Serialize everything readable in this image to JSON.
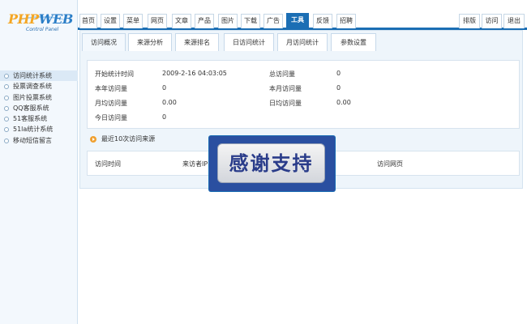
{
  "logo": {
    "brand_main": "PHP",
    "brand_accent": "WEB",
    "subtitle": "Control Panel"
  },
  "sidebar": {
    "items": [
      {
        "label": "访问统计系统",
        "active": true
      },
      {
        "label": "投票调查系统",
        "active": false
      },
      {
        "label": "图片投票系统",
        "active": false
      },
      {
        "label": "QQ客服系统",
        "active": false
      },
      {
        "label": "51客服系统",
        "active": false
      },
      {
        "label": "51la统计系统",
        "active": false
      },
      {
        "label": "移动短信留言",
        "active": false
      }
    ]
  },
  "topnav": {
    "tabs": [
      "首页",
      "设置",
      "菜单",
      "网页",
      "文章",
      "产品",
      "图片",
      "下载",
      "广告",
      "工具",
      "反馈",
      "招聘"
    ],
    "active_tab": "工具",
    "right_links": [
      "排版",
      "访问",
      "退出"
    ]
  },
  "subtabs": {
    "items": [
      "访问概况",
      "来源分析",
      "来源排名",
      "日访问统计",
      "月访问统计",
      "参数设置"
    ],
    "active": "访问概况"
  },
  "stats": {
    "start_time_label": "开始统计时间",
    "start_time_value": "2009-2-16 04:03:05",
    "total_label": "总访问量",
    "total_value": "0",
    "year_label": "本年访问量",
    "year_value": "0",
    "month_label": "本月访问量",
    "month_value": "0",
    "monthly_avg_label": "月均访问量",
    "monthly_avg_value": "0.00",
    "daily_avg_label": "日均访问量",
    "daily_avg_value": "0.00",
    "today_label": "今日访问量",
    "today_value": "0"
  },
  "recent": {
    "title": "最近10次访问来源",
    "columns": [
      "访问时间",
      "来访者IP",
      "访问网页"
    ]
  },
  "overlay": {
    "text": "感谢支持"
  },
  "colors": {
    "accent": "#1b6eb4",
    "panel_bg": "#eef5fb",
    "overlay_bg": "#2a4fa0"
  }
}
